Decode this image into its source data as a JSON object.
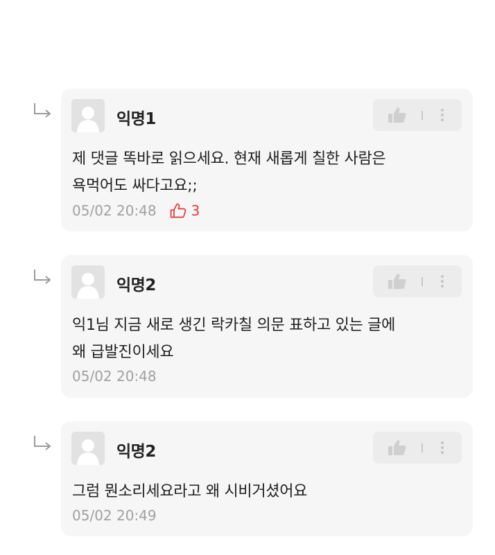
{
  "comments": [
    {
      "username": "익명1",
      "text_line1": "제 댓글 똑바로 읽으세요. 현재 새롭게 칠한 사람은",
      "text_line2": "욕먹어도 싸다고요;;",
      "timestamp": "05/02 20:48",
      "like_count": "3"
    },
    {
      "username": "익명2",
      "text_line1": "익1님 지금 새로 생긴 락카칠 의문 표하고 있는 글에",
      "text_line2": "왜 급발진이세요",
      "timestamp": "05/02 20:48"
    },
    {
      "username": "익명2",
      "text_line1": "그럼 뭔소리세요라고 왜 시비거셨어요",
      "timestamp": "05/02 20:49"
    }
  ],
  "icons": {
    "reply": "reply-arrow-icon",
    "avatar": "default-avatar-icon",
    "like": "thumbs-up-icon",
    "more": "more-vertical-icon"
  },
  "colors": {
    "card_background": "#f6f6f6",
    "action_box": "#ececec",
    "like_count_accent": "#e03a3a",
    "timestamp": "#a0a0a0"
  }
}
